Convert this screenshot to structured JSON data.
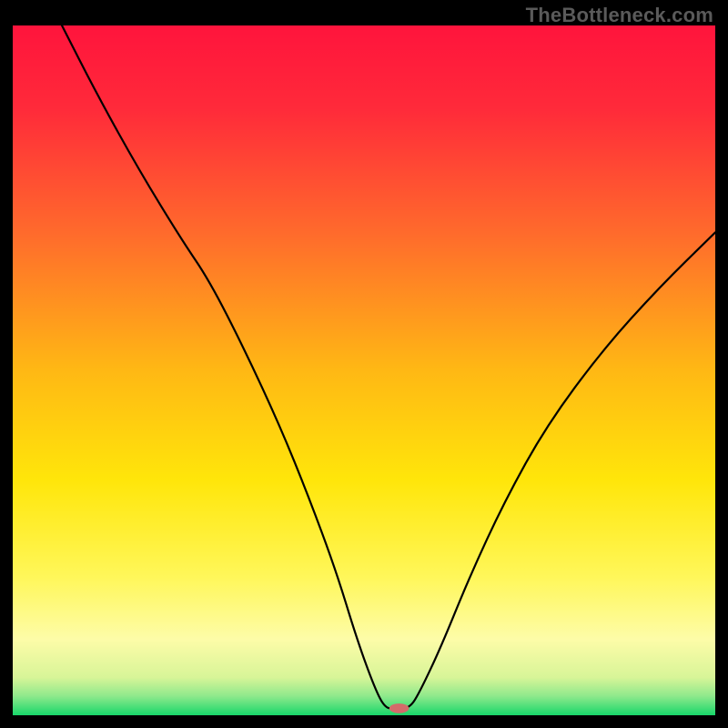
{
  "watermark": "TheBottleneck.com",
  "chart_data": {
    "type": "line",
    "title": "",
    "xlabel": "",
    "ylabel": "",
    "xlim": [
      0,
      100
    ],
    "ylim": [
      0,
      100
    ],
    "gradient_stops": [
      {
        "offset": 0.0,
        "color": "#ff143c"
      },
      {
        "offset": 0.12,
        "color": "#ff2a3a"
      },
      {
        "offset": 0.3,
        "color": "#ff6a2c"
      },
      {
        "offset": 0.5,
        "color": "#ffb814"
      },
      {
        "offset": 0.66,
        "color": "#ffe60a"
      },
      {
        "offset": 0.8,
        "color": "#fff75a"
      },
      {
        "offset": 0.89,
        "color": "#fdfca8"
      },
      {
        "offset": 0.945,
        "color": "#d8f598"
      },
      {
        "offset": 0.972,
        "color": "#8fe98c"
      },
      {
        "offset": 1.0,
        "color": "#18d76a"
      }
    ],
    "series": [
      {
        "name": "bottleneck-curve",
        "color": "#000000",
        "x": [
          7.0,
          12.0,
          18.0,
          24.0,
          28.0,
          33.0,
          38.0,
          42.0,
          46.0,
          49.0,
          51.5,
          53.0,
          54.5,
          56.5,
          58.0,
          61.0,
          65.0,
          70.0,
          76.0,
          84.0,
          92.0,
          100.0
        ],
        "y": [
          100.0,
          90.0,
          79.0,
          69.0,
          63.0,
          53.0,
          42.0,
          32.0,
          21.0,
          11.0,
          4.0,
          1.0,
          1.0,
          1.0,
          3.5,
          10.0,
          20.0,
          31.0,
          42.0,
          53.0,
          62.0,
          70.0
        ]
      }
    ],
    "marker": {
      "name": "optimal-point",
      "x": 55.0,
      "y": 1.0,
      "color": "#d46a6a",
      "rx": 1.4,
      "ry": 0.7
    }
  }
}
